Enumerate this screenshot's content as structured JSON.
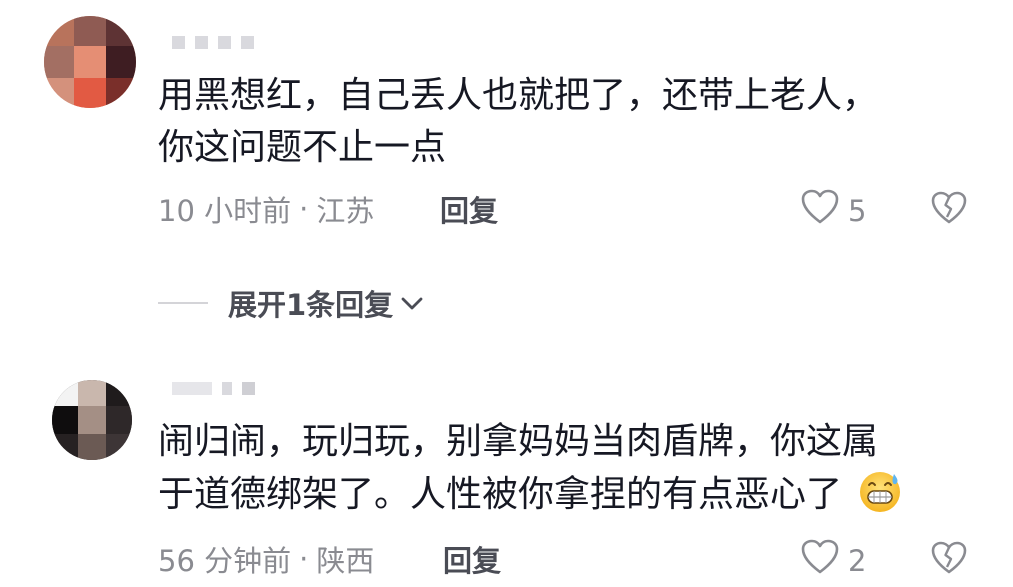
{
  "comments": [
    {
      "text_line1": "用黑想红，自己丢人也就把了，还带上老人，",
      "text_line2": "你这问题不止一点",
      "time": "10 小时前",
      "separator": "·",
      "location": "江苏",
      "reply_label": "回复",
      "like_count": "5"
    },
    {
      "text_line1": "闹归闹，玩归玩，别拿妈妈当肉盾牌，你这属",
      "text_line2": "于道德绑架了。人性被你拿捏的有点恶心了",
      "time": "56 分钟前",
      "separator": "·",
      "location": "陕西",
      "reply_label": "回复",
      "like_count": "2"
    }
  ],
  "expand_replies_label": "展开1条回复",
  "icons": {
    "like": "heart-outline-icon",
    "dislike": "broken-heart-icon",
    "expand": "chevron-down-icon",
    "emoji": "grinning-sweat-emoji-icon"
  },
  "colors": {
    "text": "#161823",
    "meta": "#8a8b91",
    "reply": "#4a4c55"
  }
}
